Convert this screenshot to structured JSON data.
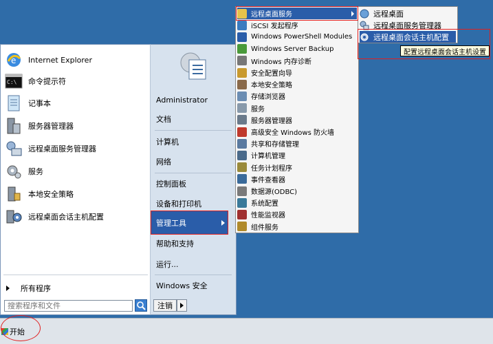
{
  "left_pane": {
    "pinned": [
      {
        "label": "Internet Explorer",
        "icon": "internet-explorer-icon"
      },
      {
        "label": "命令提示符",
        "icon": "command-prompt-icon"
      },
      {
        "label": "记事本",
        "icon": "notepad-icon"
      },
      {
        "label": "服务器管理器",
        "icon": "server-manager-icon"
      },
      {
        "label": "远程桌面服务管理器",
        "icon": "rds-manager-icon"
      },
      {
        "label": "服务",
        "icon": "services-gear-icon"
      },
      {
        "label": "本地安全策略",
        "icon": "local-security-policy-icon"
      },
      {
        "label": "远程桌面会话主机配置",
        "icon": "rdsh-config-icon"
      }
    ],
    "all_programs": "所有程序",
    "search_placeholder": "搜索程序和文件"
  },
  "right_pane": {
    "items": [
      "Administrator",
      "文档",
      "计算机",
      "网络",
      "控制面板",
      "设备和打印机",
      "管理工具",
      "帮助和支持",
      "运行...",
      "Windows 安全"
    ],
    "logoff": "注销"
  },
  "submenu": {
    "items": [
      {
        "label": "远程桌面服务",
        "icon": "folder-icon",
        "color": "#e8c24a"
      },
      {
        "label": "iSCSI 发起程序",
        "icon": "iscsi-icon",
        "color": "#3a7bbf"
      },
      {
        "label": "Windows PowerShell Modules",
        "icon": "powershell-icon",
        "color": "#2a5da9"
      },
      {
        "label": "Windows Server Backup",
        "icon": "backup-icon",
        "color": "#4a9a3a"
      },
      {
        "label": "Windows 内存诊断",
        "icon": "memory-diagnostic-icon",
        "color": "#777777"
      },
      {
        "label": "安全配置向导",
        "icon": "security-wizard-icon",
        "color": "#c99a2e"
      },
      {
        "label": "本地安全策略",
        "icon": "local-policy-icon",
        "color": "#8a6a4a"
      },
      {
        "label": "存储浏览器",
        "icon": "storage-explorer-icon",
        "color": "#6b8db3"
      },
      {
        "label": "服务",
        "icon": "services-icon",
        "color": "#8899aa"
      },
      {
        "label": "服务器管理器",
        "icon": "server-manager-small-icon",
        "color": "#6a7a8a"
      },
      {
        "label": "高级安全 Windows 防火墙",
        "icon": "firewall-icon",
        "color": "#c0392b"
      },
      {
        "label": "共享和存储管理",
        "icon": "share-storage-icon",
        "color": "#5a7aa0"
      },
      {
        "label": "计算机管理",
        "icon": "computer-management-icon",
        "color": "#4a6a8a"
      },
      {
        "label": "任务计划程序",
        "icon": "task-scheduler-icon",
        "color": "#9a8a3a"
      },
      {
        "label": "事件查看器",
        "icon": "event-viewer-icon",
        "color": "#3a6a9a"
      },
      {
        "label": "数据源(ODBC)",
        "icon": "odbc-icon",
        "color": "#7a7a7a"
      },
      {
        "label": "系统配置",
        "icon": "system-config-icon",
        "color": "#3a7a9a"
      },
      {
        "label": "性能监视器",
        "icon": "performance-monitor-icon",
        "color": "#a03030"
      },
      {
        "label": "组件服务",
        "icon": "component-services-icon",
        "color": "#b08a2a"
      }
    ]
  },
  "flyout": {
    "items": [
      {
        "label": "远程桌面",
        "icon": "remote-desktop-icon"
      },
      {
        "label": "远程桌面服务管理器",
        "icon": "rds-manager-small-icon"
      },
      {
        "label": "远程桌面会话主机配置",
        "icon": "rdsh-config-small-icon"
      }
    ]
  },
  "tooltip": "配置远程桌面会话主机设置",
  "taskbar": {
    "start_label": "开始"
  }
}
